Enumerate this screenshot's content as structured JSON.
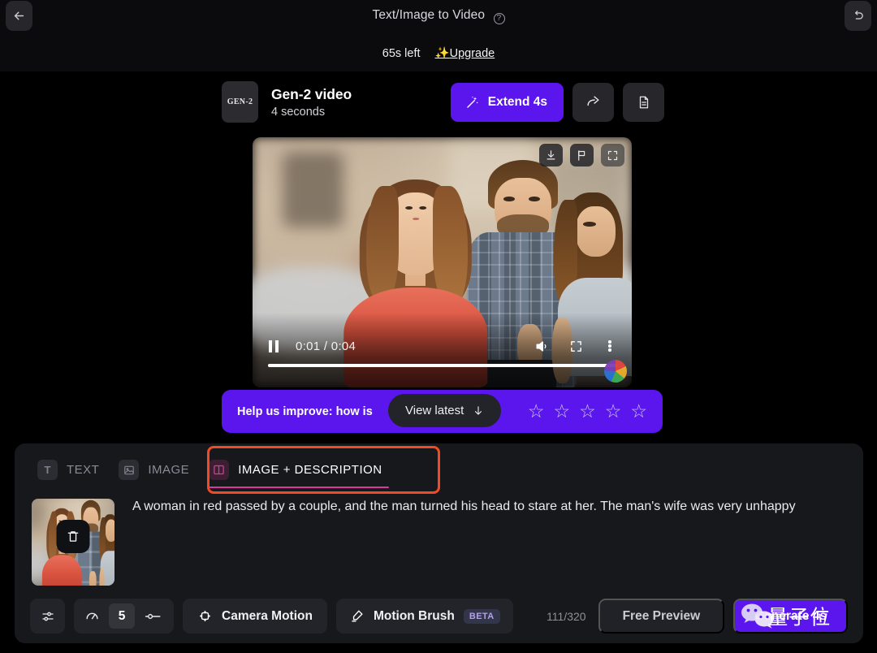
{
  "topbar": {
    "back_icon": "arrow-left-icon",
    "title": "Text/Image to Video",
    "help_icon": "question-mark-icon",
    "undo_icon": "undo-icon",
    "quota_text": "65s left",
    "upgrade_label": "Upgrade",
    "upgrade_sparkle": "✨"
  },
  "generation": {
    "badge_label": "GEN-2",
    "title": "Gen-2 video",
    "duration": "4 seconds",
    "extend_label": "Extend 4s",
    "extend_icon": "magic-wand-icon",
    "share_icon": "share-arrow-icon",
    "details_icon": "document-icon",
    "accent_purple": "#5b16ee"
  },
  "player": {
    "download_icon": "download-icon",
    "flag_icon": "flag-icon",
    "expand_icon": "expand-icon",
    "pause_icon": "pause-icon",
    "current_time": "0:01",
    "separator": "/",
    "total_time": "0:04",
    "time_display": "0:01 / 0:04",
    "volume_icon": "volume-icon",
    "fullscreen_icon": "fullscreen-icon",
    "more_icon": "kebab-menu-icon",
    "progress_percent": 100
  },
  "feedback": {
    "prompt": "Help us improve: how is",
    "stars": [
      "☆",
      "☆",
      "☆",
      "☆",
      "☆"
    ],
    "view_latest_label": "View latest",
    "view_latest_icon": "arrow-down-icon",
    "bar_color": "#5b16ee"
  },
  "panel": {
    "tabs": [
      {
        "label": "TEXT",
        "icon": "text-t-icon",
        "active": false
      },
      {
        "label": "IMAGE",
        "icon": "image-icon",
        "active": false
      },
      {
        "label": "IMAGE + DESCRIPTION",
        "icon": "image-description-icon",
        "active": true
      }
    ],
    "highlight_color": "#f04b26",
    "thumbnail": {
      "delete_icon": "trash-icon"
    },
    "description": "A woman in red passed by a couple, and the man turned his head to stare at her. The man's wife was very unhappy",
    "toolbar": {
      "settings_icon": "sliders-icon",
      "speed_icon": "gauge-icon",
      "stepper_value": "5",
      "stepper_adjust_icon": "slider-knob-icon",
      "camera_motion_label": "Camera Motion",
      "camera_motion_icon": "camera-motion-icon",
      "motion_brush_label": "Motion Brush",
      "motion_brush_icon": "brush-icon",
      "motion_brush_badge": "BETA",
      "char_counter": "111/320",
      "free_preview_label": "Free Preview",
      "generate_label": "Generate 4s",
      "watermark_icon": "wechat-icon",
      "watermark_text": "量子位"
    }
  }
}
